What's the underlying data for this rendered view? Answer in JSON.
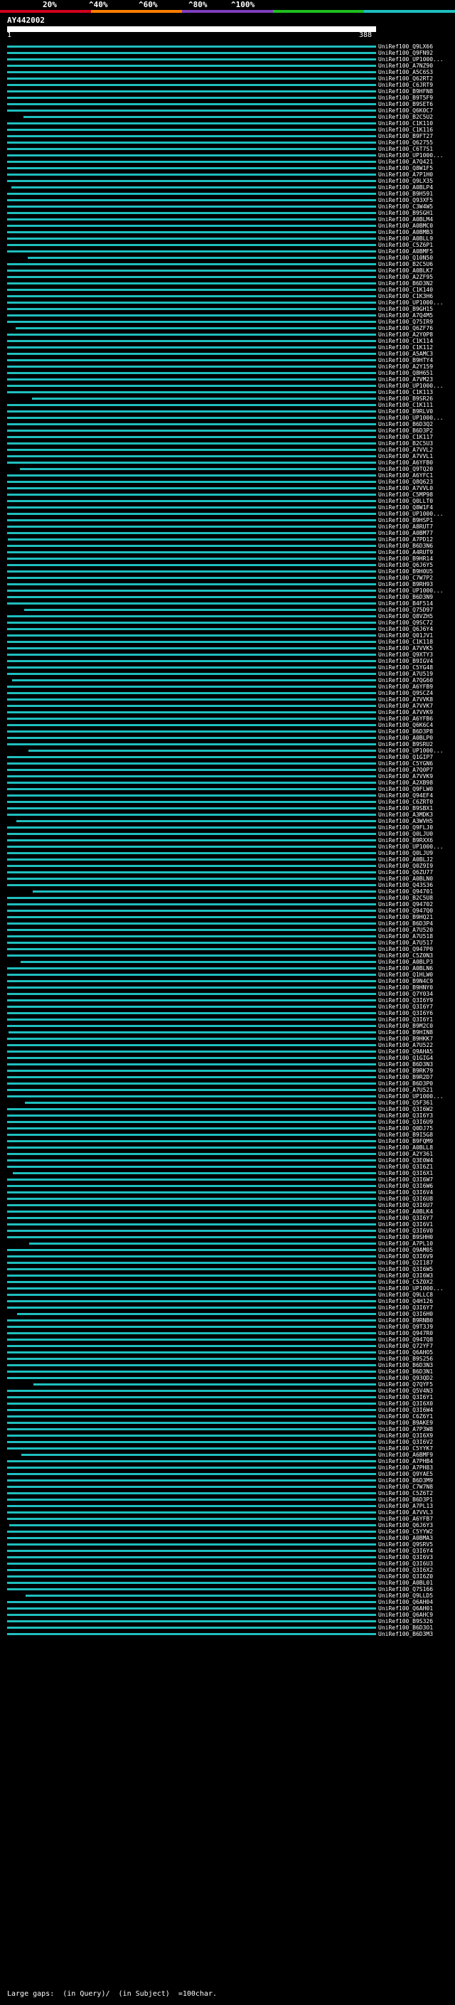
{
  "query_id": "AY442002",
  "ruler": {
    "start": "1",
    "end": "388"
  },
  "scale": {
    "labels": [
      "20%",
      "^40%",
      "^60%",
      "^80%",
      "^100%"
    ],
    "colors": [
      "#d2001e",
      "#ff7f00",
      "#7f3fbf",
      "#1ebe1e",
      "#1fbfbf"
    ]
  },
  "hit_color": "#1fbfbf",
  "hits": [
    "UniRef100_Q9LX66",
    "UniRef100_Q9FN92",
    "UniRef100_UP1000...",
    "UniRef100_A7NZ90",
    "UniRef100_A5C6S3",
    "UniRef100_Q62RT2",
    "UniRef100_C6JRT9",
    "UniRef100_B9HFN8",
    "UniRef100_B9T5F9",
    "UniRef100_B9SET6",
    "UniRef100_Q6K0C7",
    "UniRef100_B2C5U2",
    "UniRef100_C1K110",
    "UniRef100_C1K116",
    "UniRef100_B9FT27",
    "UniRef100_Q62755",
    "UniRef100_C6T7S1",
    "UniRef100_UP1000...",
    "UniRef100_A7Q421",
    "UniRef100_Q8W1F5",
    "UniRef100_A7P1H0",
    "UniRef100_Q9LX35",
    "UniRef100_A0BLP4",
    "UniRef100_B9H591",
    "UniRef100_Q93XF5",
    "UniRef100_C3W4W5",
    "UniRef100_B9SGH1",
    "UniRef100_A0BLM4",
    "UniRef100_A0BMC0",
    "UniRef100_A0BMB3",
    "UniRef100_A0BLL9",
    "UniRef100_C5Z6P1",
    "UniRef100_A0BMF5",
    "UniRef100_Q10N50",
    "UniRef100_B2C5U6",
    "UniRef100_A0BLK7",
    "UniRef100_A2ZF95",
    "UniRef100_B6D3N2",
    "UniRef100_C1K140",
    "UniRef100_C1K3H6",
    "UniRef100_UP1000...",
    "UniRef100_B9GH15",
    "UniRef100_A7Q4M5",
    "UniRef100_Q75IR9",
    "UniRef100_Q6ZF76",
    "UniRef100_A2Y0P8",
    "UniRef100_C1K114",
    "UniRef100_C1K112",
    "UniRef100_A5AMC3",
    "UniRef100_B9HTY4",
    "UniRef100_A2Y159",
    "UniRef100_Q8H651",
    "UniRef100_A7VM23",
    "UniRef100_UP1000...",
    "UniRef100_C1K113",
    "UniRef100_B9SR26",
    "UniRef100_C1K111",
    "UniRef100_B9RLV0",
    "UniRef100_UP1000...",
    "UniRef100_B6D3Q2",
    "UniRef100_B6D3P2",
    "UniRef100_C1K117",
    "UniRef100_B2C5U3",
    "UniRef100_A7VVL2",
    "UniRef100_A7VVL1",
    "UniRef100_A6YFB0",
    "UniRef100_Q9TQ20",
    "UniRef100_A6YFC1",
    "UniRef100_Q8Q623",
    "UniRef100_A7VVL0",
    "UniRef100_C5MP98",
    "UniRef100_Q0LLT0",
    "UniRef100_Q8W1F4",
    "UniRef100_UP1000...",
    "UniRef100_B9HSP1",
    "UniRef100_A8RUT7",
    "UniRef100_A0BM77",
    "UniRef100_A7PD12",
    "UniRef100_B6D3N6",
    "UniRef100_A4RUT9",
    "UniRef100_B9HR14",
    "UniRef100_Q6J6Y5",
    "UniRef100_B9H0U5",
    "UniRef100_C7W7P2",
    "UniRef100_B9RH93",
    "UniRef100_UP1000...",
    "UniRef100_B6D3N9",
    "UniRef100_B4F514",
    "UniRef100_Q75D97",
    "UniRef100_Q8VZH5",
    "UniRef100_Q9SC72",
    "UniRef100_Q6J6Y4",
    "UniRef100_Q01JV1",
    "UniRef100_C1K118",
    "UniRef100_A7VVK5",
    "UniRef100_Q9XTY3",
    "UniRef100_B9IGV4",
    "UniRef100_C5YG48",
    "UniRef100_A7U519",
    "UniRef100_A7QG60",
    "UniRef100_A6YFB9",
    "UniRef100_Q9SCZ4",
    "UniRef100_A7VVK8",
    "UniRef100_A7VVK7",
    "UniRef100_A7VVK9",
    "UniRef100_A6YFB6",
    "UniRef100_Q6K6C4",
    "UniRef100_B6D3P8",
    "UniRef100_A0BLP0",
    "UniRef100_B9SRU2",
    "UniRef100_UP1000...",
    "UniRef100_Q1GIP7",
    "UniRef100_C5YGN6",
    "UniRef100_A7Q0P7",
    "UniRef100_A7VVK9",
    "UniRef100_A2XB98",
    "UniRef100_Q9FLW0",
    "UniRef100_Q94EF4",
    "UniRef100_C6ZRT0",
    "UniRef100_B9SBX1",
    "UniRef100_A3MDK3",
    "UniRef100_A3WVH5",
    "UniRef100_Q9FLJ0",
    "UniRef100_Q0LJU0",
    "UniRef100_B9RXX6",
    "UniRef100_UP1000...",
    "UniRef100_Q0LJU9",
    "UniRef100_A0BLJ2",
    "UniRef100_Q0Z9I9",
    "UniRef100_Q6ZU77",
    "UniRef100_A0BLN0",
    "UniRef100_Q43S36",
    "UniRef100_Q94701",
    "UniRef100_B2C5U8",
    "UniRef100_Q94702",
    "UniRef100_Q947Q0",
    "UniRef100_B9HQ21",
    "UniRef100_B6D3P4",
    "UniRef100_A7U520",
    "UniRef100_A7U518",
    "UniRef100_A7U517",
    "UniRef100_Q947P0",
    "UniRef100_C5Z0N3",
    "UniRef100_A0BLP3",
    "UniRef100_A0BLN6",
    "UniRef100_Q1HLW0",
    "UniRef100_B9N4C9",
    "UniRef100_B9HNY0",
    "UniRef100_Q7Y034",
    "UniRef100_Q3I6Y9",
    "UniRef100_Q3I6Y7",
    "UniRef100_Q3I6Y6",
    "UniRef100_Q3I6Y1",
    "UniRef100_B9M2C0",
    "UniRef100_B9HIN8",
    "UniRef100_B9HKK7",
    "UniRef100_A7U522",
    "UniRef100_Q9AHA5",
    "UniRef100_Q1GIG4",
    "UniRef100_B6D3N3",
    "UniRef100_B9RK79",
    "UniRef100_B9R2D7",
    "UniRef100_B6D3P0",
    "UniRef100_A7U521",
    "UniRef100_UP1000...",
    "UniRef100_Q5F361",
    "UniRef100_Q3I6W2",
    "UniRef100_Q3I6Y3",
    "UniRef100_Q3I6U9",
    "UniRef100_Q0DJ75",
    "UniRef100_B9I5G8",
    "UniRef100_B9FQM9",
    "UniRef100_A0BLL8",
    "UniRef100_A2Y361",
    "UniRef100_Q3E0W4",
    "UniRef100_Q3I6Z1",
    "UniRef100_Q3I6X1",
    "UniRef100_Q3I6W7",
    "UniRef100_Q3I6W6",
    "UniRef100_Q3I6V4",
    "UniRef100_Q3I6U8",
    "UniRef100_Q3I6U7",
    "UniRef100_A0BLK4",
    "UniRef100_Q3I6Y7",
    "UniRef100_Q3I6V1",
    "UniRef100_Q3I6V0",
    "UniRef100_B9SHH0",
    "UniRef100_A7PL10",
    "UniRef100_Q9AM05",
    "UniRef100_Q3I6V9",
    "UniRef100_Q2I187",
    "UniRef100_Q3I6W5",
    "UniRef100_Q3I6W3",
    "UniRef100_C5Z0X2",
    "UniRef100_UP1000...",
    "UniRef100_Q9LLC8",
    "UniRef100_Q4H126",
    "UniRef100_Q3I6Y7",
    "UniRef100_Q3I6H0",
    "UniRef100_B9RNB0",
    "UniRef100_Q9T3J9",
    "UniRef100_Q947R0",
    "UniRef100_Q947Q8",
    "UniRef100_Q72YF7",
    "UniRef100_Q6AHO5",
    "UniRef100_B9S256",
    "UniRef100_B6D3N3",
    "UniRef100_B6D3N1",
    "UniRef100_Q93QD2",
    "UniRef100_Q7QYF5",
    "UniRef100_Q5V4N3",
    "UniRef100_Q3I6Y1",
    "UniRef100_Q3I6X0",
    "UniRef100_Q3I6W4",
    "UniRef100_C6Z6Y1",
    "UniRef100_B9AKE9",
    "UniRef100_A7P3W8",
    "UniRef100_Q3I6X9",
    "UniRef100_Q3I6V2",
    "UniRef100_C5YYK7",
    "UniRef100_A6BMF9",
    "UniRef100_A7PHB4",
    "UniRef100_A7PH83",
    "UniRef100_Q9YAE5",
    "UniRef100_B6D3M9",
    "UniRef100_C7W7N8",
    "UniRef100_C5Z6T2",
    "UniRef100_B6D3P1",
    "UniRef100_A7PL13",
    "UniRef100_A7VVL3",
    "UniRef100_A6YFB7",
    "UniRef100_Q6J6Y3",
    "UniRef100_C5YYW2",
    "UniRef100_A0BMA3",
    "UniRef100_Q9SRV5",
    "UniRef100_Q3I6Y4",
    "UniRef100_Q3I6V3",
    "UniRef100_Q3I6U3",
    "UniRef100_Q3I6X2",
    "UniRef100_Q3I6Z0",
    "UniRef100_A0BL01",
    "UniRef100_Q7S166",
    "UniRef100_Q9LLD5",
    "UniRef100_Q6AH04",
    "UniRef100_Q6AH01",
    "UniRef100_Q6AHC9",
    "UniRef100_B9S326",
    "UniRef100_B6D3O1",
    "UniRef100_B6D3M3"
  ],
  "footer": {
    "label": "Large gaps:",
    "query_gap": "(in Query)/",
    "subject_gap": "(in Subject)",
    "scale_note": "=100char."
  }
}
